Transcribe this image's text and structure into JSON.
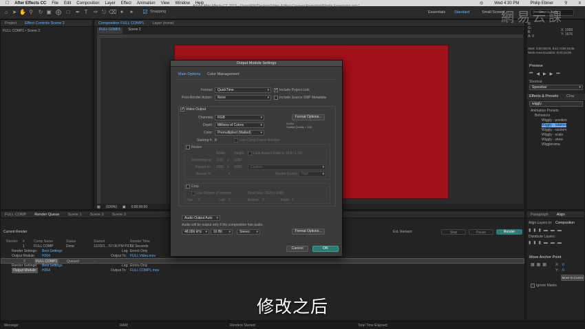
{
  "menubar": {
    "app": "After Effects CC",
    "items": [
      "File",
      "Edit",
      "Composition",
      "Layer",
      "Effect",
      "Animation",
      "View",
      "Window",
      "Help"
    ],
    "time": "Wed 4:30 PM",
    "user": "Philip Ebiner"
  },
  "toolbar": {
    "snapping": "Snapping",
    "doc_title": "Adobe After Effects CC 2019 - /Users/Phil/Desktop/Video Editing Courses/Animation/Wiggle Expression.aep *",
    "workspaces": [
      "Essentials",
      "Standard",
      "Small Screen"
    ],
    "search_placeholder": "Search Help"
  },
  "project_panel": {
    "tabs": [
      "Project",
      "Effect Controls Scene 2"
    ],
    "breadcrumb": "FULL COMP1 • Scene 2"
  },
  "comp_panel": {
    "tabs": [
      "Composition FULL COMP1",
      "Layer (none)"
    ],
    "sub_tabs": [
      "FULL COMP1",
      "Scene 2"
    ],
    "zoom": "(100%)",
    "timecode": "0;00;00;00"
  },
  "dialog": {
    "title": "Output Module Settings",
    "tabs": [
      "Main Options",
      "Color Management"
    ],
    "format_label": "Format:",
    "format_value": "QuickTime",
    "include_project_link": "Include Project Link",
    "post_render_label": "Post-Render Action:",
    "post_render_value": "None",
    "include_xmp": "Include Source XMP Metadata",
    "video_output": "Video Output",
    "channels_label": "Channels:",
    "channels_value": "RGB",
    "format_options_btn": "Format Options...",
    "depth_label": "Depth:",
    "depth_value": "Millions of Colors",
    "codec_line1": "H.264",
    "codec_line2": "Spatial Quality = 100",
    "color_label": "Color:",
    "color_value": "Premultiplied (Matted)",
    "starting_label": "Starting #:",
    "starting_value": "0",
    "use_comp_frame": "Use Comp Frame Number",
    "resize": "Resize",
    "width_h": "Width",
    "height_h": "Height",
    "lock_aspect": "Lock Aspect Ratio to 16:9 (1.78)",
    "rendering_at": "Rendering at:",
    "rendering_w": "1920",
    "rendering_h": "1080",
    "resize_to": "Resize to:",
    "resize_w": "1920",
    "resize_h": "1080",
    "custom": "Custom",
    "resize_pct": "Resize %:",
    "resize_quality": "Resize Quality:",
    "quality_value": "High",
    "crop": "Crop",
    "use_roi": "Use Region of Interest",
    "final_size": "Final Size: 1920 x 1080",
    "top": "Top:",
    "top_v": "0",
    "left": "Left:",
    "left_v": "0",
    "bottom": "Bottom:",
    "bottom_v": "0",
    "right": "Right:",
    "right_v": "0",
    "audio_output": "Audio Output Auto",
    "audio_note": "Audio will be output only if the composition has audio.",
    "khz": "48.000 kHz",
    "bit": "16 Bit",
    "stereo": "Stereo",
    "audio_format_options": "Format Options...",
    "cancel": "Cancel",
    "ok": "OK"
  },
  "timeline": {
    "tabs": [
      "FULL COMP",
      "Render Queue",
      "Scene 1",
      "Scene 2",
      "Scene 3"
    ],
    "current_render": "Current Render",
    "est_remain": "Est. Remain:",
    "stop": "Stop",
    "pause": "Pause",
    "render": "Render",
    "headers": [
      "Render",
      "#",
      "Comp Name",
      "Status",
      "Started",
      "Render Time"
    ],
    "rows": [
      {
        "num": "1",
        "name": "FULL COMP",
        "status": "Done",
        "started": "12/22/1...:57:06 PM PST",
        "time": "18 Seconds"
      },
      {
        "label": "Render Settings:",
        "value": "Best Settings",
        "log_label": "Log:",
        "log": "Errors Only"
      },
      {
        "label": "Output Module:",
        "value": "H264",
        "out_label": "Output To:",
        "out": "FULL Video.mov"
      },
      {
        "num": "2",
        "name": "FULL COMP1",
        "status": "Queued",
        "started": "-",
        "time": ""
      },
      {
        "label": "Render Settings:",
        "value": "Best Settings",
        "log_label": "Log:",
        "log": "Errors Only"
      },
      {
        "label": "Output Module:",
        "value": "H264",
        "out_label": "Output To:",
        "out": "FULL COMP1.mov"
      }
    ]
  },
  "info_panel": {
    "r": "R:",
    "g": "G:",
    "b": "B:",
    "a": "A: 0",
    "x": "X: 1956",
    "y": "Y: 1676",
    "start": "Start: 0;00;00;00, End: 0;00;16;05",
    "duration": "Work Area Duration: 0;00;16;06"
  },
  "preview_panel": {
    "title": "Preview",
    "shortcut": "Shortcut",
    "shortcut_value": "Spacebar"
  },
  "effects_panel": {
    "title": "Effects & Presets",
    "char_tab": "Char",
    "search_value": "wiggly",
    "items": [
      "Animation Presets",
      "Behaviors",
      "Wiggly - position",
      "Wiggly - rotation",
      "Wiggly - random",
      "Wiggly - scale",
      "Wiggly - skew",
      "Wigglerama"
    ]
  },
  "align_panel": {
    "tabs": [
      "Paragraph",
      "Align"
    ],
    "align_layers_to": "Align Layers to:",
    "align_target": "Composition",
    "distribute": "Distribute Layers:"
  },
  "anchor_panel": {
    "title": "Move Anchor Point",
    "x_label": "X:",
    "x_value": "0",
    "y_label": "Y:",
    "y_value": "0",
    "ignore_masks": "Ignore Masks",
    "move_to_cursor": "Move to Cursor"
  },
  "statusbar": {
    "message": "Message:",
    "ram": "RAM:",
    "renders_started": "Renders Started:",
    "total_time": "Total Time Elapsed:"
  },
  "overlay": {
    "subtitle": "修改之后",
    "watermark": "網易云課"
  }
}
